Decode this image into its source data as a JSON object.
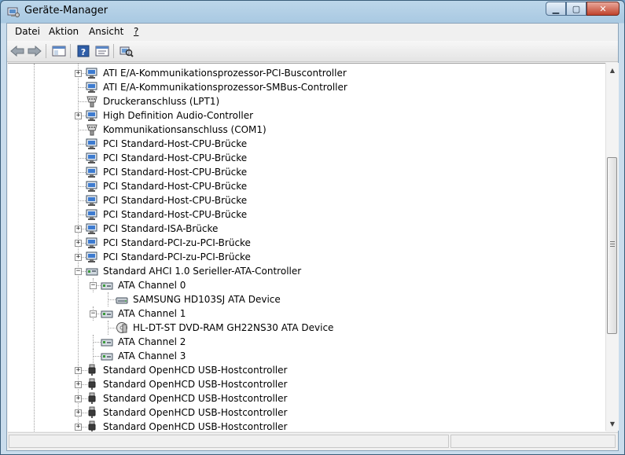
{
  "window": {
    "title": "Geräte-Manager"
  },
  "menu": [
    {
      "label": "Datei"
    },
    {
      "label": "Aktion"
    },
    {
      "label": "Ansicht"
    },
    {
      "label": "?"
    }
  ],
  "toolbar": {
    "icons": [
      "back-arrow-icon",
      "forward-arrow-icon",
      "show-hide-console-tree-icon",
      "help-icon",
      "properties-icon",
      "scan-hardware-icon"
    ]
  },
  "tree": {
    "items": [
      {
        "label": "ATI E/A-Kommunikationsprozessor-PCI-Buscontroller",
        "level": 0,
        "expander": "+",
        "icon": "monitor-icon"
      },
      {
        "label": "ATI E/A-Kommunikationsprozessor-SMBus-Controller",
        "level": 0,
        "expander": "none",
        "icon": "monitor-icon"
      },
      {
        "label": "Druckeranschluss (LPT1)",
        "level": 0,
        "expander": "none",
        "icon": "port-icon"
      },
      {
        "label": "High Definition Audio-Controller",
        "level": 0,
        "expander": "+",
        "icon": "monitor-icon"
      },
      {
        "label": "Kommunikationsanschluss (COM1)",
        "level": 0,
        "expander": "none",
        "icon": "port-icon"
      },
      {
        "label": "PCI Standard-Host-CPU-Brücke",
        "level": 0,
        "expander": "none",
        "icon": "monitor-icon"
      },
      {
        "label": "PCI Standard-Host-CPU-Brücke",
        "level": 0,
        "expander": "none",
        "icon": "monitor-icon"
      },
      {
        "label": "PCI Standard-Host-CPU-Brücke",
        "level": 0,
        "expander": "none",
        "icon": "monitor-icon"
      },
      {
        "label": "PCI Standard-Host-CPU-Brücke",
        "level": 0,
        "expander": "none",
        "icon": "monitor-icon"
      },
      {
        "label": "PCI Standard-Host-CPU-Brücke",
        "level": 0,
        "expander": "none",
        "icon": "monitor-icon"
      },
      {
        "label": "PCI Standard-Host-CPU-Brücke",
        "level": 0,
        "expander": "none",
        "icon": "monitor-icon"
      },
      {
        "label": "PCI Standard-ISA-Brücke",
        "level": 0,
        "expander": "+",
        "icon": "monitor-icon"
      },
      {
        "label": "PCI Standard-PCI-zu-PCI-Brücke",
        "level": 0,
        "expander": "+",
        "icon": "monitor-icon"
      },
      {
        "label": "PCI Standard-PCI-zu-PCI-Brücke",
        "level": 0,
        "expander": "+",
        "icon": "monitor-icon"
      },
      {
        "label": "Standard AHCI 1.0 Serieller-ATA-Controller",
        "level": 0,
        "expander": "-",
        "icon": "ide-controller-icon"
      },
      {
        "label": "ATA Channel 0",
        "level": 1,
        "expander": "-",
        "icon": "ide-channel-icon"
      },
      {
        "label": "SAMSUNG HD103SJ ATA Device",
        "level": 2,
        "expander": "none",
        "icon": "hard-disk-icon"
      },
      {
        "label": "ATA Channel 1",
        "level": 1,
        "expander": "-",
        "icon": "ide-channel-icon"
      },
      {
        "label": "HL-DT-ST DVD-RAM GH22NS30 ATA Device",
        "level": 2,
        "expander": "none",
        "icon": "optical-drive-icon"
      },
      {
        "label": "ATA Channel 2",
        "level": 1,
        "expander": "none",
        "icon": "ide-channel-icon"
      },
      {
        "label": "ATA Channel 3",
        "level": 1,
        "expander": "none",
        "icon": "ide-channel-icon"
      },
      {
        "label": "Standard OpenHCD USB-Hostcontroller",
        "level": 0,
        "expander": "+",
        "icon": "usb-plug-icon"
      },
      {
        "label": "Standard OpenHCD USB-Hostcontroller",
        "level": 0,
        "expander": "+",
        "icon": "usb-plug-icon"
      },
      {
        "label": "Standard OpenHCD USB-Hostcontroller",
        "level": 0,
        "expander": "+",
        "icon": "usb-plug-icon"
      },
      {
        "label": "Standard OpenHCD USB-Hostcontroller",
        "level": 0,
        "expander": "+",
        "icon": "usb-plug-icon"
      },
      {
        "label": "Standard OpenHCD USB-Hostcontroller",
        "level": 0,
        "expander": "+",
        "icon": "usb-plug-icon"
      }
    ]
  },
  "scrollbar": {
    "position": 0.52
  }
}
